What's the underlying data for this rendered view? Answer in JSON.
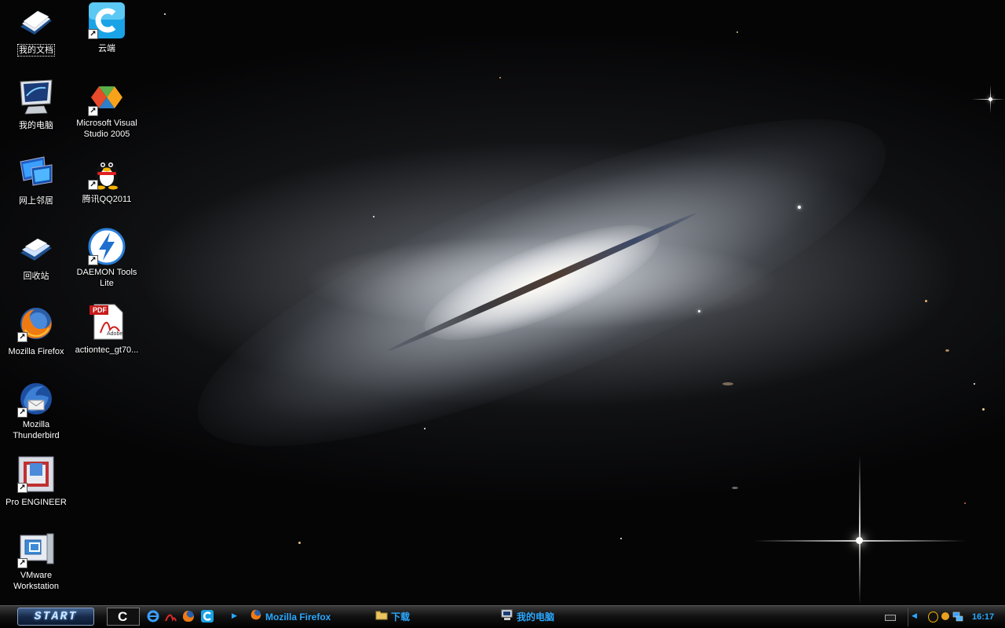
{
  "desktop_icons": [
    {
      "label": "我的文档",
      "icon": "my-documents-icon",
      "shortcut": false,
      "selected": true
    },
    {
      "label": "云端",
      "icon": "cloud-app-icon",
      "shortcut": true
    },
    {
      "label": "我的电脑",
      "icon": "my-computer-icon",
      "shortcut": false
    },
    {
      "label": "Microsoft Visual Studio 2005",
      "icon": "visual-studio-icon",
      "shortcut": true
    },
    {
      "label": "网上邻居",
      "icon": "network-places-icon",
      "shortcut": false
    },
    {
      "label": "腾讯QQ2011",
      "icon": "qq-penguin-icon",
      "shortcut": true
    },
    {
      "label": "回收站",
      "icon": "recycle-bin-icon",
      "shortcut": false
    },
    {
      "label": "DAEMON Tools Lite",
      "icon": "daemon-tools-icon",
      "shortcut": true
    },
    {
      "label": "Mozilla Firefox",
      "icon": "firefox-icon",
      "shortcut": true
    },
    {
      "label": "actiontec_gt70...",
      "icon": "pdf-file-icon",
      "shortcut": false
    },
    {
      "label": "Mozilla Thunderbird",
      "icon": "thunderbird-icon",
      "shortcut": true
    },
    {
      "label": "Pro ENGINEER",
      "icon": "pro-engineer-icon",
      "shortcut": true
    },
    {
      "label": "VMware Workstation",
      "icon": "vmware-icon",
      "shortcut": true
    }
  ],
  "pdf_badge": "PDF",
  "pdf_brand": "Adobe",
  "taskbar": {
    "start_label": "START",
    "quick_launch": [
      "cloud-app-icon",
      "ie-icon",
      "acrobat-icon",
      "firefox-icon",
      "cloud-app-icon"
    ],
    "tasks": [
      {
        "label": "Mozilla Firefox",
        "icon": "firefox-icon"
      },
      {
        "label": "下载",
        "icon": "folder-icon"
      },
      {
        "label": "我的电脑",
        "icon": "my-computer-icon"
      }
    ],
    "clock": "16:17",
    "tray_icons": [
      "keyboard-icon",
      "show-hidden-icon",
      "qq-tray-icon",
      "security-tray-icon",
      "network-tray-icon"
    ]
  },
  "colors": {
    "taskbar_text": "#2aa8ff",
    "start_glow": "#6ab0ff"
  }
}
